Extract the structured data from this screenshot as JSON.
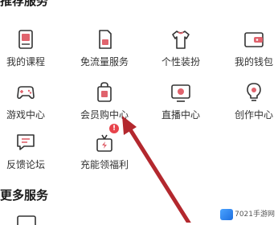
{
  "sections": {
    "recommended_title": "推荐服务",
    "more_title": "更多服务"
  },
  "services": [
    {
      "label": "我的课程",
      "icon": "course-book-icon"
    },
    {
      "label": "免流量服务",
      "icon": "sim-card-icon"
    },
    {
      "label": "个性装扮",
      "icon": "tshirt-icon"
    },
    {
      "label": "我的钱包",
      "icon": "wallet-icon"
    },
    {
      "label": "游戏中心",
      "icon": "gamepad-icon"
    },
    {
      "label": "会员购中心",
      "icon": "shopping-bag-icon"
    },
    {
      "label": "直播中心",
      "icon": "live-tv-icon"
    },
    {
      "label": "创作中心",
      "icon": "lightbulb-icon"
    },
    {
      "label": "反馈论坛",
      "icon": "feedback-chat-icon"
    },
    {
      "label": "充能领福利",
      "icon": "gift-box-icon",
      "badge": "!"
    }
  ],
  "watermark": {
    "text": "7021手游网"
  },
  "colors": {
    "icon_accent": "#e0636d",
    "arrow": "#b3282e",
    "badge": "#e8434b"
  }
}
